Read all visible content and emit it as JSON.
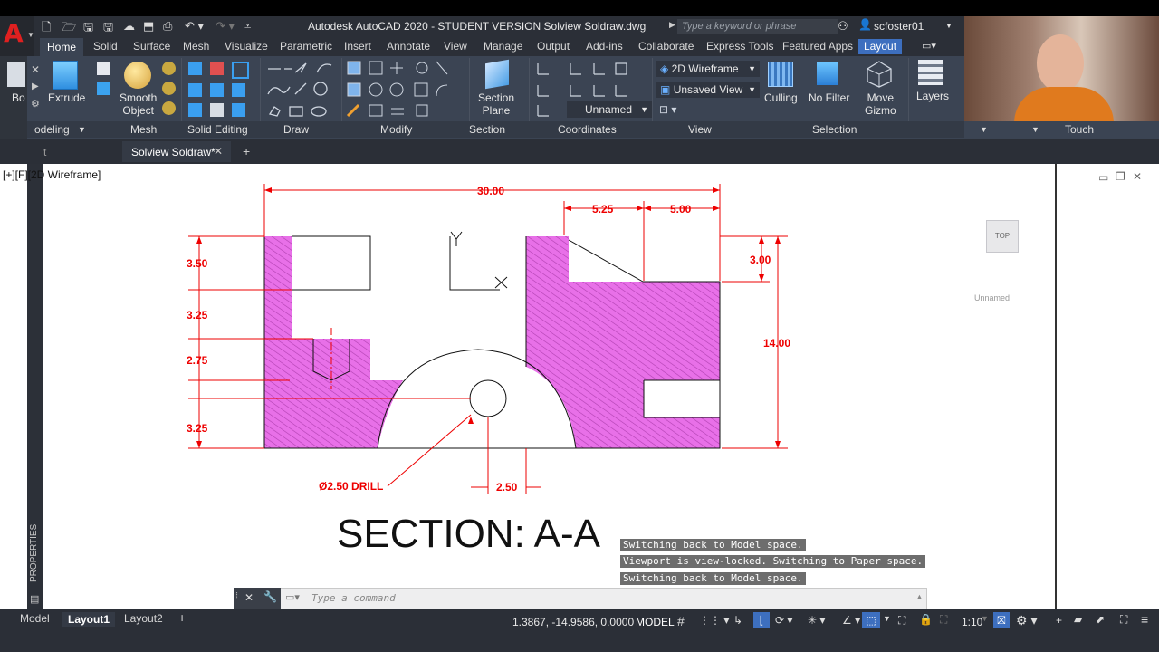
{
  "app": {
    "title": "Autodesk AutoCAD 2020 - STUDENT VERSION    Solview Soldraw.dwg",
    "logo_letter": "A",
    "search_placeholder": "Type a keyword or phrase",
    "user": "scfoster01"
  },
  "ribbon_tabs": [
    "Home",
    "Solid",
    "Surface",
    "Mesh",
    "Visualize",
    "Parametric",
    "Insert",
    "Annotate",
    "View",
    "Manage",
    "Output",
    "Add-ins",
    "Collaborate",
    "Express Tools",
    "Featured Apps",
    "Layout"
  ],
  "active_tab": "Home",
  "ribbon": {
    "box_label": "Bo",
    "extrude": "Extrude",
    "smooth_object": "Smooth\nObject",
    "section_plane": "Section\nPlane",
    "culling": "Culling",
    "no_filter": "No Filter",
    "move_gizmo": "Move\nGizmo",
    "layers": "Layers",
    "visual_style": "2D Wireframe",
    "view_state": "Unsaved View",
    "ucs_state": "Unnamed",
    "panel_titles": [
      "odeling",
      "Mesh",
      "Solid Editing",
      "Draw",
      "Modify",
      "Section",
      "Coordinates",
      "View",
      "Selection",
      "Touch"
    ]
  },
  "file_tabs": {
    "first": "t",
    "active": "Solview Soldraw*",
    "add": "+"
  },
  "viewport": {
    "label": "[+][F",
    "label2": "][2D Wireframe]",
    "viewcube": "TOP",
    "ucs_badge": "Unnamed",
    "properties_strip": "PROPERTIES"
  },
  "drawing": {
    "dims": {
      "overall_width": "30.00",
      "d_5_25": "5.25",
      "d_5_00": "5.00",
      "d_3_50": "3.50",
      "d_3_25a": "3.25",
      "d_2_75": "2.75",
      "d_3_25b": "3.25",
      "d_3_00": "3.00",
      "d_14_00": "14.00",
      "d_2_50": "2.50",
      "drill": "Ø2.50 DRILL"
    },
    "section_title": "SECTION: A-A",
    "hatch_color": "#e070e0",
    "dim_color": "#e00000"
  },
  "command_history": [
    "Switching back to Model space.",
    "Viewport is view-locked. Switching to Paper space.",
    "Switching back to Model space."
  ],
  "command_placeholder": "Type a command",
  "layout_tabs": [
    "Model",
    "Layout1",
    "Layout2"
  ],
  "active_layout": "Layout1",
  "status": {
    "coords": "1.3867, -14.9586, 0.0000",
    "space": "MODEL",
    "scale": "1:10"
  }
}
